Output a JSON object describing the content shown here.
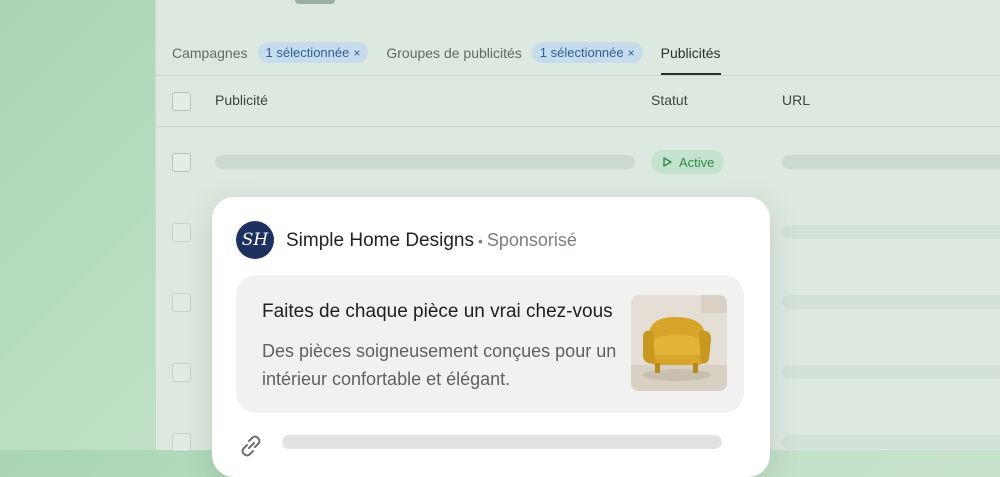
{
  "filters": {
    "campaigns_label": "Campagnes",
    "campaigns_chip": "1 sélectionnée",
    "adgroups_label": "Groupes de publicités",
    "adgroups_chip": "1 sélectionnée",
    "ads_tab": "Publicités",
    "remove_glyph": "×"
  },
  "table": {
    "columns": [
      "Publicité",
      "Statut",
      "URL"
    ],
    "rows": [
      {
        "status": "Active"
      }
    ]
  },
  "ad_preview": {
    "avatar_initials": "SH",
    "advertiser": "Simple Home Designs",
    "separator": "•",
    "sponsored": "Sponsorisé",
    "headline": "Faites de chaque pièce un vrai chez-vous",
    "description": "Des pièces soigneusement conçues pour un intérieur confortable et élégant.",
    "image": "yellow-armchair-image"
  },
  "colors": {
    "background_green": "#bfe0c6",
    "chip_blue": "#c6dcec",
    "status_green": "#2f8a4c",
    "avatar_navy": "#1c3160"
  }
}
